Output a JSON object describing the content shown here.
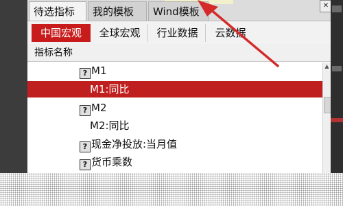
{
  "top_tabs": [
    {
      "label": "待选指标",
      "active": true
    },
    {
      "label": "我的模板",
      "active": false
    },
    {
      "label": "Wind模板",
      "active": false
    }
  ],
  "close_button": {
    "icon": "close-icon",
    "glyph": "✕"
  },
  "sub_tabs": [
    {
      "label": "中国宏观",
      "active": true
    },
    {
      "label": "全球宏观",
      "active": false
    },
    {
      "label": "行业数据",
      "active": false
    },
    {
      "label": "云数据",
      "active": false
    }
  ],
  "column_header": "指标名称",
  "list": {
    "items": [
      {
        "label": "M1",
        "has_icon": true,
        "selected": false
      },
      {
        "label": "M1:同比",
        "has_icon": false,
        "selected": true
      },
      {
        "label": "M2",
        "has_icon": true,
        "selected": false
      },
      {
        "label": "M2:同比",
        "has_icon": false,
        "selected": false
      },
      {
        "label": "现金净投放:当月值",
        "has_icon": true,
        "selected": false
      },
      {
        "label": "货币乘数",
        "has_icon": true,
        "selected": false
      }
    ],
    "icon_glyph": "?"
  },
  "scrollbar": {
    "up_glyph": "▲"
  },
  "colors": {
    "accent": "#c81b1b",
    "selection": "#c01f1f",
    "arrow": "#d42a2a"
  }
}
